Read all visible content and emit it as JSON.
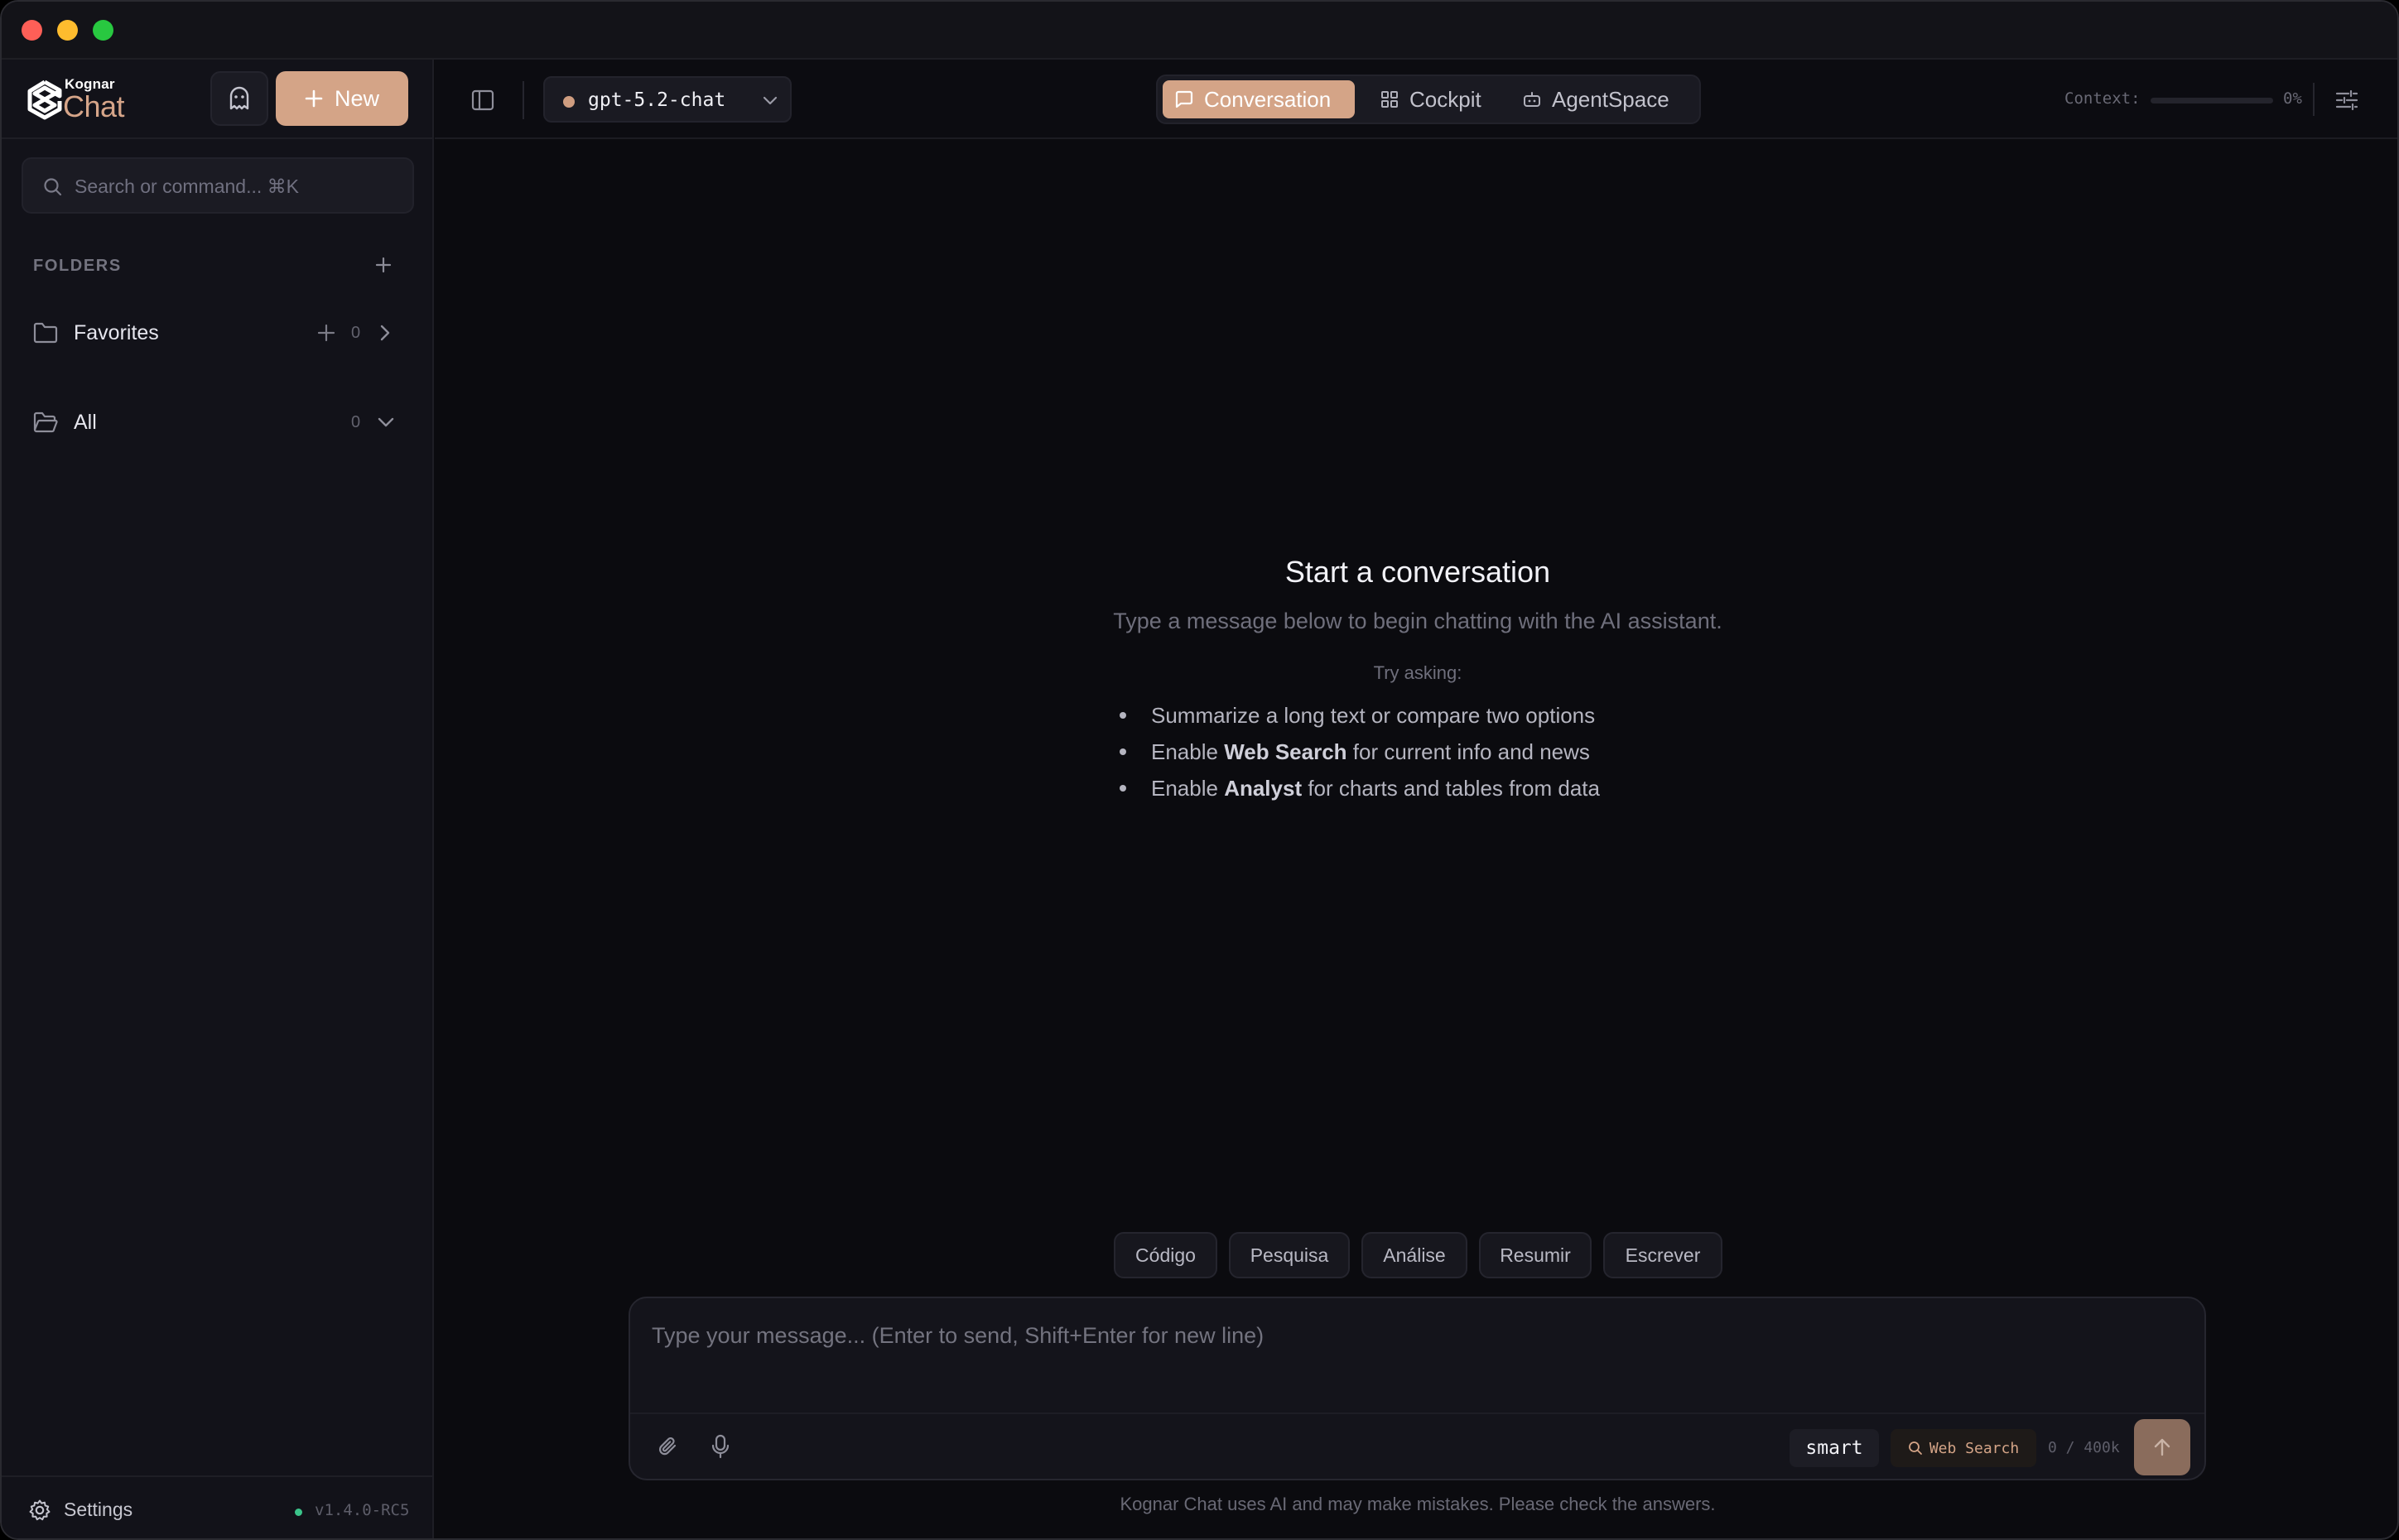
{
  "colors": {
    "accent": "#d4a487",
    "background": "#0b0b0f",
    "sidebar": "#121219",
    "status_online": "#3bc48a"
  },
  "sidebar": {
    "logo_small": "Kognar",
    "logo_big": "Chat",
    "new_label": "New",
    "ghost_icon": "ghost-icon",
    "search_placeholder": "Search or command... ⌘K",
    "folders_label": "FOLDERS",
    "folders": [
      {
        "name": "Favorites",
        "count": "0",
        "icon": "folder-icon",
        "expanded": false
      },
      {
        "name": "All",
        "count": "0",
        "icon": "folder-open-icon",
        "expanded": true
      }
    ],
    "settings_label": "Settings",
    "version": "v1.4.0-RC5"
  },
  "topbar": {
    "model": "gpt-5.2-chat",
    "tabs": [
      {
        "label": "Conversation",
        "icon": "message-square-icon",
        "active": true
      },
      {
        "label": "Cockpit",
        "icon": "layout-grid-icon",
        "active": false
      },
      {
        "label": "AgentSpace",
        "icon": "bot-icon",
        "active": false
      }
    ],
    "context_label": "Context:",
    "context_value": "0%",
    "context_fraction": 0
  },
  "main": {
    "title": "Start a conversation",
    "subtitle": "Type a message below to begin chatting with the AI assistant.",
    "try_label": "Try asking:",
    "suggestions": [
      {
        "before": "Summarize a long text or compare two options",
        "bold": "",
        "after": ""
      },
      {
        "before": "Enable ",
        "bold": "Web Search",
        "after": " for current info and news"
      },
      {
        "before": "Enable ",
        "bold": "Analyst",
        "after": " for charts and tables from data"
      }
    ],
    "chips": [
      "Código",
      "Pesquisa",
      "Análise",
      "Resumir",
      "Escrever"
    ]
  },
  "composer": {
    "placeholder": "Type your message... (Enter to send, Shift+Enter for new line)",
    "mode": "smart",
    "web_search": "Web Search",
    "token_count": "0 / 400k",
    "disclaimer": "Kognar Chat uses AI and may make mistakes. Please check the answers."
  }
}
